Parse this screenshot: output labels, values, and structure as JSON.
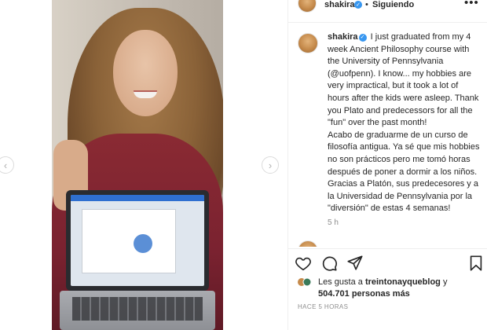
{
  "post_header": {
    "username": "shakira",
    "separator": "•",
    "follow_status": "Siguiendo",
    "more_label": "•••"
  },
  "caption": {
    "username": "shakira",
    "text_en": "I just graduated from my 4 week Ancient Philosophy course with the University of Pennsylvania (@uofpenn). I know... my hobbies are very impractical, but it took a lot of hours after the kids were asleep. Thank you Plato and predecessors for all the \"fun\" over the past month!",
    "text_es": "Acabo de graduarme de un curso de filosofía antigua. Ya sé que mis hobbies no son prácticos pero me tomó horas después de poner a dormir a los niños. Gracias a Platón, sus predecesores y a la Universidad de Pennsylvania por la \"diversión\" de estas 4 semanas!",
    "time": "5 h"
  },
  "carousel": {
    "prev_label": "‹",
    "next_label": "›"
  },
  "likes": {
    "prefix": "Les gusta a ",
    "user": "treintonayqueblog",
    "conj": " y",
    "count": "504.701 personas más"
  },
  "posted_ago": "HACE 5 HORAS",
  "colors": {
    "verified": "#3897f0",
    "text": "#262626",
    "muted": "#8e8e8e",
    "shirt": "#7a2230"
  },
  "icons": [
    "verified-badge-icon",
    "heart-icon",
    "comment-icon",
    "share-icon",
    "bookmark-icon",
    "more-icon"
  ]
}
